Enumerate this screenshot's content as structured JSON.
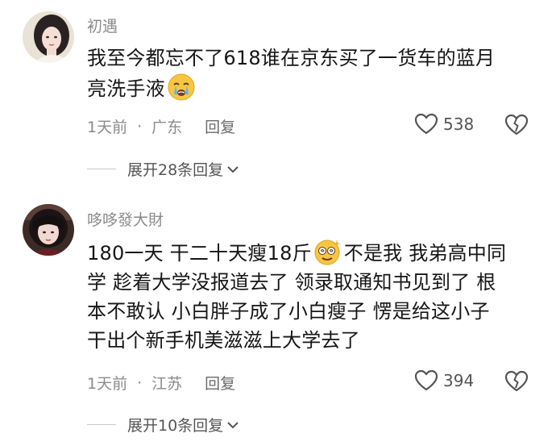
{
  "comments": [
    {
      "username": "初遇",
      "lines": [
        "我至今都忘不了618谁在京东买了一货车的蓝月",
        "亮洗手液"
      ],
      "emoji": "crying-face-icon",
      "time": "1天前",
      "location": "广东",
      "reply_label": "回复",
      "likes": "538",
      "expand_label": "展开28条回复"
    },
    {
      "username": "哆哆發大財",
      "line1_a": "180一天 干二十天瘦18斤",
      "line1_b": "不是我 我弟高中同",
      "lines": [
        "学 趁着大学没报道去了 领录取通知书见到了 根",
        "本不敢认 小白胖子成了小白瘦子 愣是给这小子",
        "干出个新手机美滋滋上大学去了"
      ],
      "emoji": "dizzy-face-icon",
      "time": "1天前",
      "location": "江苏",
      "reply_label": "回复",
      "likes": "394",
      "expand_label": "展开10条回复"
    }
  ],
  "separator": "·",
  "colors": {
    "meta_text": "#8a8a8a",
    "body_text": "#161616",
    "background": "#ffffff"
  }
}
